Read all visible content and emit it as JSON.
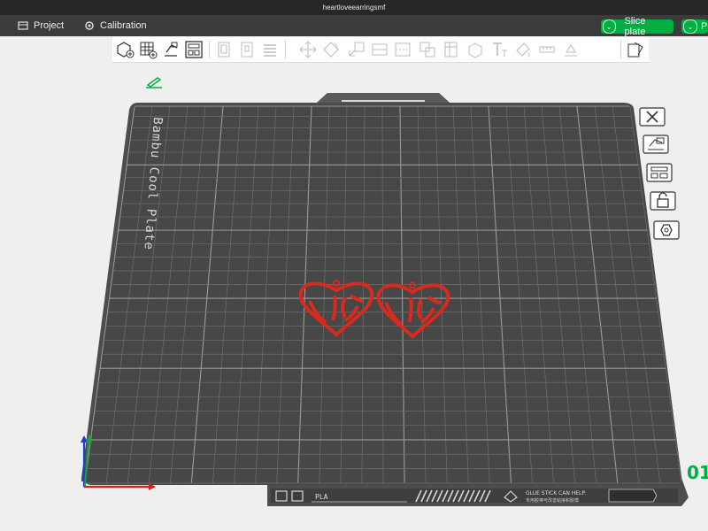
{
  "window": {
    "title": "heartloveearringsmf"
  },
  "menubar": {
    "project_label": "Project",
    "calibration_label": "Calibration",
    "slice_label": "Slice plate",
    "print_label": "P"
  },
  "plate": {
    "name": "Bambu Cool Plate",
    "filament": "PLA",
    "notice_line1": "GLUE STICK CAN HELP.",
    "notice_line2": "专用胶棒可改善粘接和脱模"
  },
  "viewport": {
    "corner_readout": "01"
  },
  "colors": {
    "accent": "#00ae42",
    "plate": "#4c4c4c",
    "model": "#d82a1e",
    "background": "#efefef"
  },
  "toolbar_icons": [
    "add-object-icon",
    "add-plate-icon",
    "auto-orient-icon",
    "arrange-icon",
    "copy-icon",
    "paste-icon",
    "layers-icon",
    "move-icon",
    "rotate-icon",
    "scale-icon",
    "lay-on-face-icon",
    "cut-icon",
    "split-icon",
    "boolean-icon",
    "support-paint-icon",
    "text-icon",
    "paint-icon",
    "measure-icon",
    "assembly-icon",
    "view-icon"
  ]
}
